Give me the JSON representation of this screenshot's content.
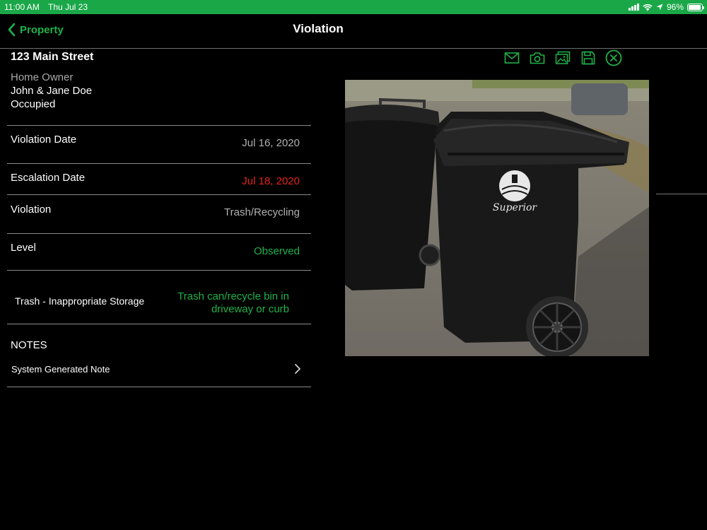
{
  "status_bar": {
    "time": "11:00 AM",
    "date": "Thu Jul 23",
    "battery": "96%",
    "battery_level": 0.96,
    "color": "#1aa748"
  },
  "nav": {
    "back_label": "Property",
    "title": "Violation"
  },
  "property": {
    "address": "123 Main Street",
    "owner_label": "Home Owner",
    "owner_name": "John & Jane Doe",
    "occupancy": "Occupied"
  },
  "details": [
    {
      "label": "Violation Date",
      "value": "Jul 16, 2020",
      "color": "gray"
    },
    {
      "label": "Escalation Date",
      "value": "Jul 18, 2020",
      "color": "red"
    },
    {
      "label": "Violation",
      "value": "Trash/Recycling",
      "color": "gray"
    },
    {
      "label": "Level",
      "value": "Observed",
      "color": "green"
    }
  ],
  "violation_detail": {
    "label": "Trash - Inappropriate Storage",
    "value_line1": "Trash can/recycle bin in",
    "value_line2": "driveway or curb"
  },
  "notes": {
    "heading": "NOTES",
    "items": [
      {
        "label": "System Generated Note"
      }
    ]
  },
  "toolbar": {
    "icons": [
      "mail-icon",
      "camera-icon",
      "gallery-icon",
      "save-icon",
      "close-circle-icon"
    ]
  },
  "photo": {
    "bin_brand": "Superior"
  },
  "colors": {
    "accent": "#1fb24a",
    "alert": "#e3241b",
    "background": "#000000"
  }
}
